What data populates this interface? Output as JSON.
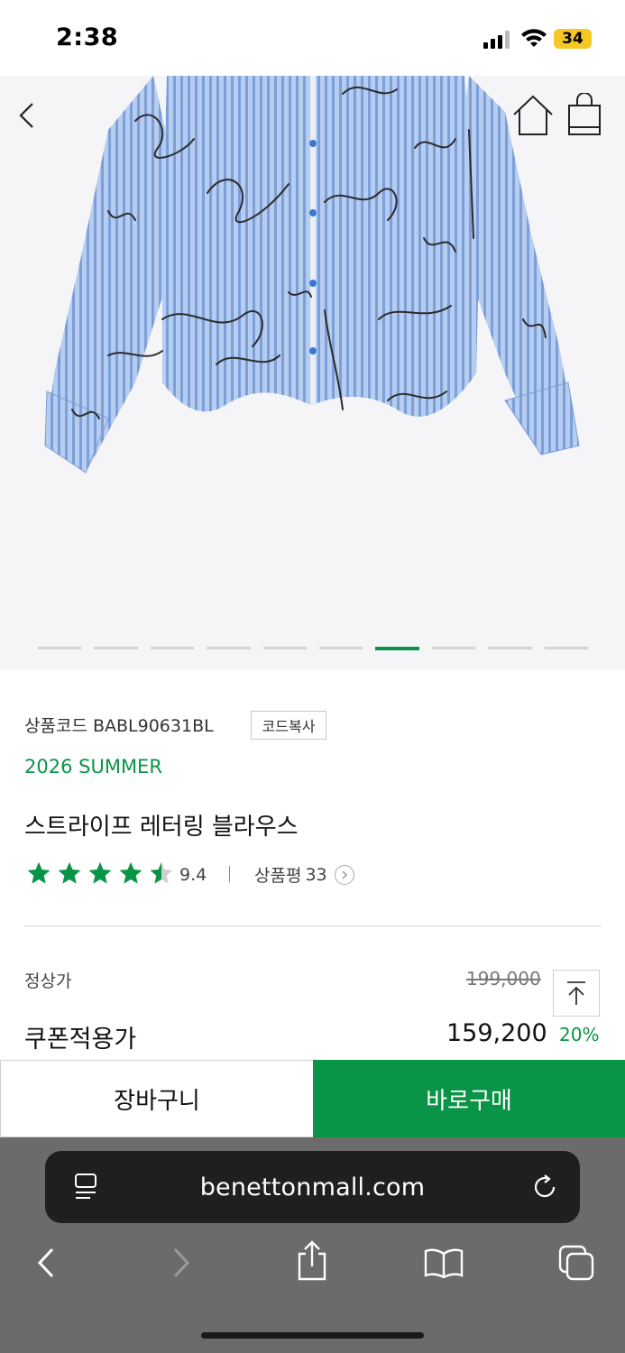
{
  "status_bar": {
    "time": "2:38",
    "battery": "34",
    "battery_color": "#f7c824"
  },
  "product_image": {
    "alt": "blue striped blouse with lettering print",
    "page_count": 10,
    "active_index": 6
  },
  "product": {
    "code_label": "상품코드",
    "code": "BABL90631BL",
    "copy_button": "코드복사",
    "season": "2026 SUMMER",
    "name": "스트라이프 레터링 블라우스",
    "rating": "9.4",
    "rating_stars": 4.5,
    "review_label": "상품평",
    "review_count": "33"
  },
  "price": {
    "regular_label": "정상가",
    "regular_price": "199,000",
    "coupon_label": "쿠폰적용가",
    "coupon_price": "159,200",
    "discount": "20%"
  },
  "actions": {
    "cart": "장바구니",
    "buy": "바로구매"
  },
  "browser": {
    "url": "benettonmall.com"
  },
  "colors": {
    "accent": "#0a9447",
    "toolbar": "#6b6b6b",
    "url_bar": "#1f1f1f"
  }
}
